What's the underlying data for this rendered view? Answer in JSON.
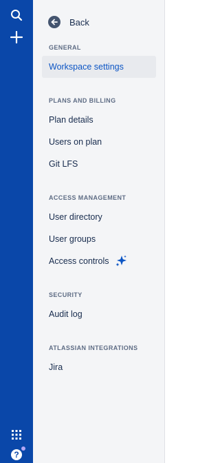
{
  "global_nav": {
    "icons": [
      "search-icon",
      "plus-icon",
      "app-switcher-icon",
      "help-icon"
    ],
    "help_glyph": "?",
    "background": "#0a47a9"
  },
  "sidebar": {
    "back_label": "Back",
    "sections": [
      {
        "title": "GENERAL",
        "items": [
          {
            "label": "Workspace settings",
            "active": true
          }
        ]
      },
      {
        "title": "PLANS AND BILLING",
        "items": [
          {
            "label": "Plan details"
          },
          {
            "label": "Users on plan"
          },
          {
            "label": "Git LFS"
          }
        ]
      },
      {
        "title": "ACCESS MANAGEMENT",
        "items": [
          {
            "label": "User directory"
          },
          {
            "label": "User groups"
          },
          {
            "label": "Access controls",
            "icon": "sparkle-icon"
          }
        ]
      },
      {
        "title": "SECURITY",
        "items": [
          {
            "label": "Audit log"
          }
        ]
      },
      {
        "title": "ATLASSIAN INTEGRATIONS",
        "items": [
          {
            "label": "Jira"
          }
        ]
      }
    ]
  },
  "colors": {
    "active_text": "#0c55c4",
    "sidebar_bg": "#f4f5f7",
    "sparkle": "#0c55c4"
  }
}
